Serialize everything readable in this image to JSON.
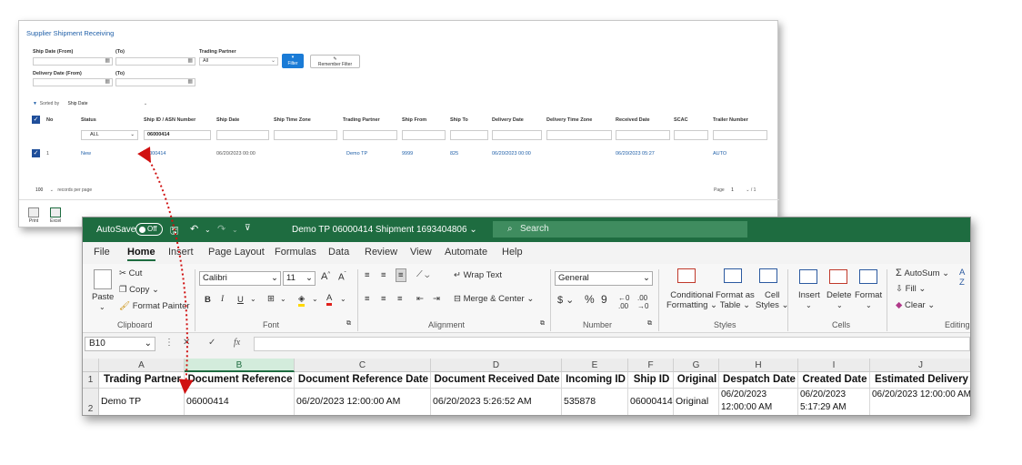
{
  "web": {
    "title": "Supplier Shipment Receiving",
    "ship_date_from_label": "Ship Date (From)",
    "to_label": "(To)",
    "trading_partner_label": "Trading Partner",
    "trading_partner_value": "All",
    "delivery_date_from_label": "Delivery Date (From)",
    "delivery_to_label": "(To)",
    "filter_button": "Filter",
    "remember_filter_button": "Remember Filter",
    "sorted_by_label": "Sorted by",
    "sorted_by_value": "Ship Date",
    "columns": [
      "No",
      "Status",
      "Ship ID / ASN Number",
      "Ship Date",
      "Ship Time Zone",
      "Trading Partner",
      "Ship From",
      "Ship To",
      "Delivery Date",
      "Delivery Time Zone",
      "Received Date",
      "SCAC",
      "Trailer Number"
    ],
    "status_filter": "ALL",
    "ship_id_filter": "06000414",
    "row": {
      "no": "1",
      "status": "New",
      "ship_id": "06000414",
      "ship_date": "06/20/2023 00:00",
      "trading_partner": "Demo TP",
      "ship_from": "9999",
      "ship_to": "825",
      "delivery_date": "06/20/2023 00:00",
      "received_date": "06/20/2023 05:27",
      "trailer_number": "AUTO"
    },
    "records_per_page": "100",
    "records_per_page_label": "records per page",
    "page_label": "Page",
    "page_current": "1",
    "page_total": "/ 1",
    "print_label": "Print",
    "excel_label": "Excel"
  },
  "excel": {
    "autosave_label": "AutoSave",
    "autosave_state": "Off",
    "doc_title": "Demo TP 06000414 Shipment 1693404806",
    "search_placeholder": "Search",
    "menu": [
      "File",
      "Home",
      "Insert",
      "Page Layout",
      "Formulas",
      "Data",
      "Review",
      "View",
      "Automate",
      "Help"
    ],
    "ribbon": {
      "paste": "Paste",
      "cut": "Cut",
      "copy": "Copy",
      "format_painter": "Format Painter",
      "clipboard": "Clipboard",
      "font_name": "Calibri",
      "font_size": "11",
      "font": "Font",
      "wrap_text": "Wrap Text",
      "merge_center": "Merge & Center",
      "alignment": "Alignment",
      "number_format": "General",
      "number": "Number",
      "conditional_formatting_1": "Conditional",
      "conditional_formatting_2": "Formatting",
      "format_as_table_1": "Format as",
      "format_as_table_2": "Table",
      "cell_styles_1": "Cell",
      "cell_styles_2": "Styles",
      "styles": "Styles",
      "insert": "Insert",
      "delete": "Delete",
      "format": "Format",
      "cells": "Cells",
      "autosum": "AutoSum",
      "fill": "Fill",
      "clear": "Clear",
      "editing": "Editing"
    },
    "name_box": "B10",
    "fx": "fx",
    "col_letters": [
      "A",
      "B",
      "C",
      "D",
      "E",
      "F",
      "G",
      "H",
      "I",
      "J"
    ],
    "row_numbers": [
      "1",
      "2"
    ],
    "headers": [
      "Trading Partner",
      "Document Reference",
      "Document Reference Date",
      "Document Received Date",
      "Incoming ID",
      "Ship ID",
      "Original",
      "Despatch Date",
      "Created Date",
      "Estimated Delivery"
    ],
    "row2": [
      "Demo TP",
      "06000414",
      "06/20/2023 12:00:00 AM",
      "06/20/2023 5:26:52 AM",
      "535878",
      "06000414",
      "Original",
      "06/20/2023 12:00:00 AM",
      "06/20/2023 5:17:29 AM",
      "06/20/2023 12:00:00 AM"
    ]
  }
}
